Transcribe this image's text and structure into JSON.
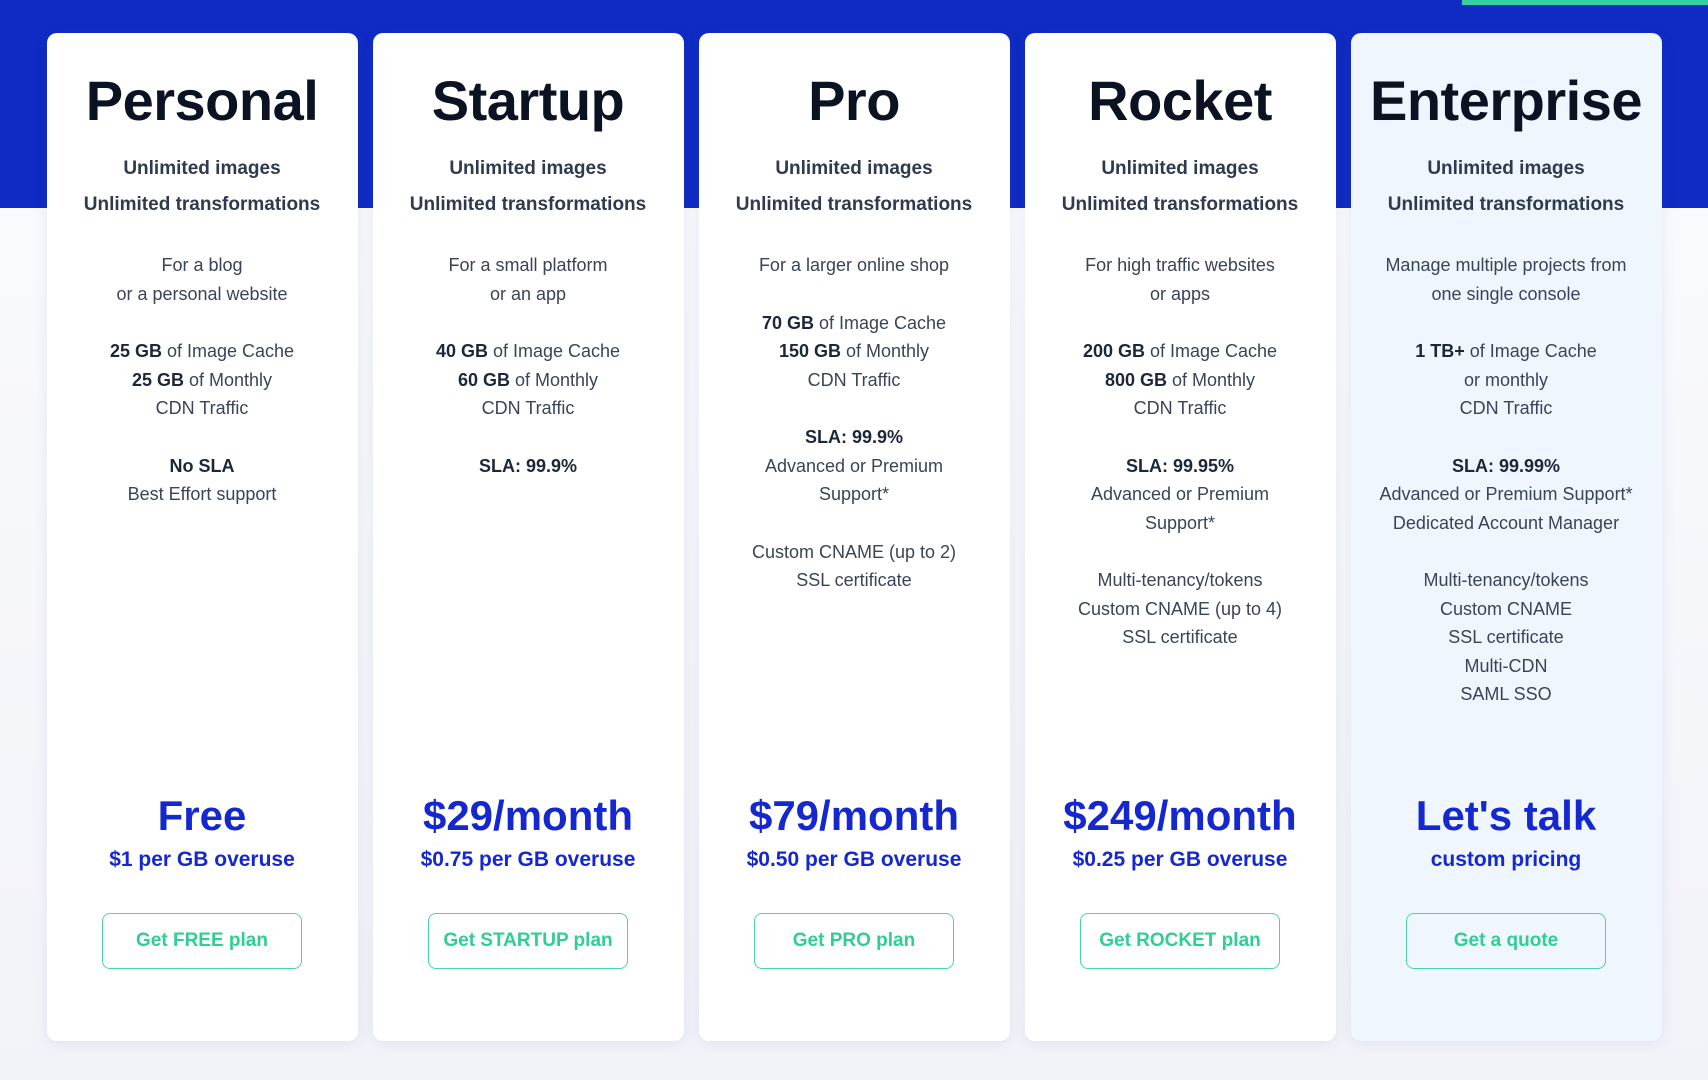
{
  "theme": {
    "band_blue": "#0f2bc4",
    "accent_green": "#37cfa5",
    "price_blue": "#1528cf",
    "cta_green": "#2ecf92",
    "highlight_bg": "#f0f6fe",
    "page_bg": "#f4f5fa"
  },
  "plans": [
    {
      "name": "Personal",
      "headline": [
        "Unlimited images",
        "Unlimited transformations"
      ],
      "groups": [
        [
          "For a blog",
          "or a personal website"
        ],
        [
          "<b>25 GB</b> of Image Cache",
          "<b>25 GB</b> of Monthly",
          "CDN Traffic"
        ],
        [
          "<b>No SLA</b>",
          "Best Effort support"
        ]
      ],
      "price": "Free",
      "price_sub": "$1 per GB overuse",
      "cta": "Get FREE plan",
      "highlight": false
    },
    {
      "name": "Startup",
      "headline": [
        "Unlimited images",
        "Unlimited transformations"
      ],
      "groups": [
        [
          "For a small platform",
          "or an app"
        ],
        [
          "<b>40 GB</b> of Image Cache",
          "<b>60 GB</b> of Monthly",
          "CDN Traffic"
        ],
        [
          "<b>SLA: 99.9%</b>"
        ]
      ],
      "price": "$29/month",
      "price_sub": "$0.75 per GB overuse",
      "cta": "Get STARTUP plan",
      "highlight": false
    },
    {
      "name": "Pro",
      "headline": [
        "Unlimited images",
        "Unlimited transformations"
      ],
      "groups": [
        [
          "For a larger online shop"
        ],
        [
          "<b>70 GB</b> of Image Cache",
          "<b>150 GB</b> of Monthly",
          "CDN Traffic"
        ],
        [
          "<b>SLA: 99.9%</b>",
          "Advanced or Premium",
          "Support*"
        ],
        [
          "Custom CNAME (up to 2)",
          "SSL certificate"
        ]
      ],
      "price": "$79/month",
      "price_sub": "$0.50 per GB overuse",
      "cta": "Get PRO plan",
      "highlight": false
    },
    {
      "name": "Rocket",
      "headline": [
        "Unlimited images",
        "Unlimited transformations"
      ],
      "groups": [
        [
          "For high traffic websites",
          "or apps"
        ],
        [
          "<b>200 GB</b> of Image Cache",
          "<b>800 GB</b> of Monthly",
          "CDN Traffic"
        ],
        [
          "<b>SLA: 99.95%</b>",
          "Advanced or Premium",
          "Support*"
        ],
        [
          "Multi-tenancy/tokens",
          "Custom CNAME (up to 4)",
          "SSL certificate"
        ]
      ],
      "price": "$249/month",
      "price_sub": "$0.25 per GB overuse",
      "cta": "Get ROCKET plan",
      "highlight": false
    },
    {
      "name": "Enterprise",
      "headline": [
        "Unlimited images",
        "Unlimited transformations"
      ],
      "groups": [
        [
          "Manage multiple projects from",
          "one single console"
        ],
        [
          "<b>1 TB+</b> of Image Cache",
          "or monthly",
          "CDN Traffic"
        ],
        [
          "<b>SLA: 99.99%</b>",
          "Advanced or Premium Support*",
          "Dedicated Account Manager"
        ],
        [
          "Multi-tenancy/tokens",
          "Custom CNAME",
          "SSL certificate",
          "Multi-CDN",
          "SAML SSO"
        ]
      ],
      "price": "Let's talk",
      "price_sub": "custom pricing",
      "cta": "Get a quote",
      "highlight": true
    }
  ]
}
